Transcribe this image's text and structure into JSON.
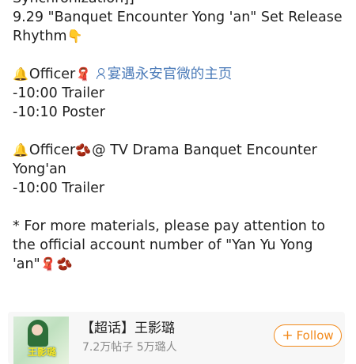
{
  "post": {
    "line1": "Synchronization]]",
    "line2": "9.29 \"Banquet Encounter Yong 'an\" Set Release",
    "line3_text": "Rhythm",
    "line3_emoji": "👇",
    "officer1_bell": "🔔",
    "officer1_label": "Officer",
    "officer1_scarf": "🧣",
    "officer1_link": "宴遇永安官微的主页",
    "officer1_item1": "-10:00 Trailer",
    "officer1_item2": "-10:10 Poster",
    "officer2_bell": "🔔",
    "officer2_label": "Officer",
    "officer2_beans": "🫘",
    "officer2_mention": "@ TV Drama Banquet Encounter",
    "officer2_mention_cont": "Yong'an",
    "officer2_item1": "-10:00 Trailer",
    "note_line1": "* For more materials, please pay attention to",
    "note_line2": "the official account number of \"Yan Yu Yong",
    "note_line3_text": "'an\"",
    "note_line3_scarf": "🧣",
    "note_line3_beans": "🫘"
  },
  "supertopic_card": {
    "thumb_text": "王影璐",
    "title": "【超话】王影璐",
    "meta": "7.2万帖子 5万璐人",
    "follow_label": "Follow",
    "follow_icon": "plus-icon",
    "accent_color": "#f28a1c"
  }
}
